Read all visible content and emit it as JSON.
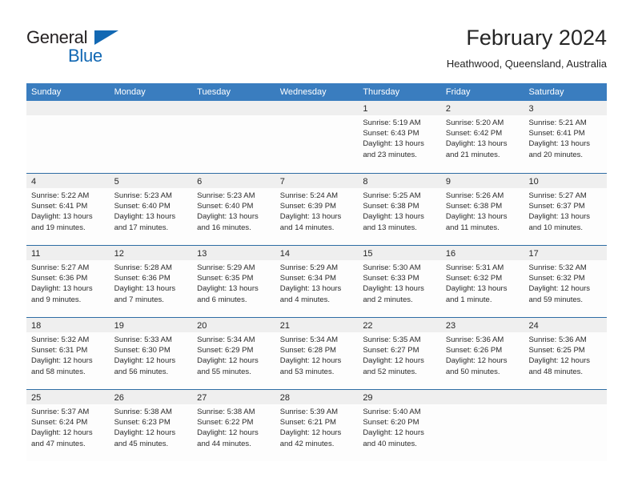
{
  "brand": {
    "name_part1": "General",
    "name_part2": "Blue",
    "triangle_icon": "triangle-icon",
    "accent_color": "#1268b3"
  },
  "header": {
    "title": "February 2024",
    "subtitle": "Heathwood, Queensland, Australia"
  },
  "calendar": {
    "header_color": "#3a7dbf",
    "weekdays": [
      "Sunday",
      "Monday",
      "Tuesday",
      "Wednesday",
      "Thursday",
      "Friday",
      "Saturday"
    ],
    "weeks": [
      [
        {
          "day": "",
          "lines": []
        },
        {
          "day": "",
          "lines": []
        },
        {
          "day": "",
          "lines": []
        },
        {
          "day": "",
          "lines": []
        },
        {
          "day": "1",
          "lines": [
            "Sunrise: 5:19 AM",
            "Sunset: 6:43 PM",
            "Daylight: 13 hours",
            "and 23 minutes."
          ]
        },
        {
          "day": "2",
          "lines": [
            "Sunrise: 5:20 AM",
            "Sunset: 6:42 PM",
            "Daylight: 13 hours",
            "and 21 minutes."
          ]
        },
        {
          "day": "3",
          "lines": [
            "Sunrise: 5:21 AM",
            "Sunset: 6:41 PM",
            "Daylight: 13 hours",
            "and 20 minutes."
          ]
        }
      ],
      [
        {
          "day": "4",
          "lines": [
            "Sunrise: 5:22 AM",
            "Sunset: 6:41 PM",
            "Daylight: 13 hours",
            "and 19 minutes."
          ]
        },
        {
          "day": "5",
          "lines": [
            "Sunrise: 5:23 AM",
            "Sunset: 6:40 PM",
            "Daylight: 13 hours",
            "and 17 minutes."
          ]
        },
        {
          "day": "6",
          "lines": [
            "Sunrise: 5:23 AM",
            "Sunset: 6:40 PM",
            "Daylight: 13 hours",
            "and 16 minutes."
          ]
        },
        {
          "day": "7",
          "lines": [
            "Sunrise: 5:24 AM",
            "Sunset: 6:39 PM",
            "Daylight: 13 hours",
            "and 14 minutes."
          ]
        },
        {
          "day": "8",
          "lines": [
            "Sunrise: 5:25 AM",
            "Sunset: 6:38 PM",
            "Daylight: 13 hours",
            "and 13 minutes."
          ]
        },
        {
          "day": "9",
          "lines": [
            "Sunrise: 5:26 AM",
            "Sunset: 6:38 PM",
            "Daylight: 13 hours",
            "and 11 minutes."
          ]
        },
        {
          "day": "10",
          "lines": [
            "Sunrise: 5:27 AM",
            "Sunset: 6:37 PM",
            "Daylight: 13 hours",
            "and 10 minutes."
          ]
        }
      ],
      [
        {
          "day": "11",
          "lines": [
            "Sunrise: 5:27 AM",
            "Sunset: 6:36 PM",
            "Daylight: 13 hours",
            "and 9 minutes."
          ]
        },
        {
          "day": "12",
          "lines": [
            "Sunrise: 5:28 AM",
            "Sunset: 6:36 PM",
            "Daylight: 13 hours",
            "and 7 minutes."
          ]
        },
        {
          "day": "13",
          "lines": [
            "Sunrise: 5:29 AM",
            "Sunset: 6:35 PM",
            "Daylight: 13 hours",
            "and 6 minutes."
          ]
        },
        {
          "day": "14",
          "lines": [
            "Sunrise: 5:29 AM",
            "Sunset: 6:34 PM",
            "Daylight: 13 hours",
            "and 4 minutes."
          ]
        },
        {
          "day": "15",
          "lines": [
            "Sunrise: 5:30 AM",
            "Sunset: 6:33 PM",
            "Daylight: 13 hours",
            "and 2 minutes."
          ]
        },
        {
          "day": "16",
          "lines": [
            "Sunrise: 5:31 AM",
            "Sunset: 6:32 PM",
            "Daylight: 13 hours",
            "and 1 minute."
          ]
        },
        {
          "day": "17",
          "lines": [
            "Sunrise: 5:32 AM",
            "Sunset: 6:32 PM",
            "Daylight: 12 hours",
            "and 59 minutes."
          ]
        }
      ],
      [
        {
          "day": "18",
          "lines": [
            "Sunrise: 5:32 AM",
            "Sunset: 6:31 PM",
            "Daylight: 12 hours",
            "and 58 minutes."
          ]
        },
        {
          "day": "19",
          "lines": [
            "Sunrise: 5:33 AM",
            "Sunset: 6:30 PM",
            "Daylight: 12 hours",
            "and 56 minutes."
          ]
        },
        {
          "day": "20",
          "lines": [
            "Sunrise: 5:34 AM",
            "Sunset: 6:29 PM",
            "Daylight: 12 hours",
            "and 55 minutes."
          ]
        },
        {
          "day": "21",
          "lines": [
            "Sunrise: 5:34 AM",
            "Sunset: 6:28 PM",
            "Daylight: 12 hours",
            "and 53 minutes."
          ]
        },
        {
          "day": "22",
          "lines": [
            "Sunrise: 5:35 AM",
            "Sunset: 6:27 PM",
            "Daylight: 12 hours",
            "and 52 minutes."
          ]
        },
        {
          "day": "23",
          "lines": [
            "Sunrise: 5:36 AM",
            "Sunset: 6:26 PM",
            "Daylight: 12 hours",
            "and 50 minutes."
          ]
        },
        {
          "day": "24",
          "lines": [
            "Sunrise: 5:36 AM",
            "Sunset: 6:25 PM",
            "Daylight: 12 hours",
            "and 48 minutes."
          ]
        }
      ],
      [
        {
          "day": "25",
          "lines": [
            "Sunrise: 5:37 AM",
            "Sunset: 6:24 PM",
            "Daylight: 12 hours",
            "and 47 minutes."
          ]
        },
        {
          "day": "26",
          "lines": [
            "Sunrise: 5:38 AM",
            "Sunset: 6:23 PM",
            "Daylight: 12 hours",
            "and 45 minutes."
          ]
        },
        {
          "day": "27",
          "lines": [
            "Sunrise: 5:38 AM",
            "Sunset: 6:22 PM",
            "Daylight: 12 hours",
            "and 44 minutes."
          ]
        },
        {
          "day": "28",
          "lines": [
            "Sunrise: 5:39 AM",
            "Sunset: 6:21 PM",
            "Daylight: 12 hours",
            "and 42 minutes."
          ]
        },
        {
          "day": "29",
          "lines": [
            "Sunrise: 5:40 AM",
            "Sunset: 6:20 PM",
            "Daylight: 12 hours",
            "and 40 minutes."
          ]
        },
        {
          "day": "",
          "lines": []
        },
        {
          "day": "",
          "lines": []
        }
      ]
    ]
  }
}
